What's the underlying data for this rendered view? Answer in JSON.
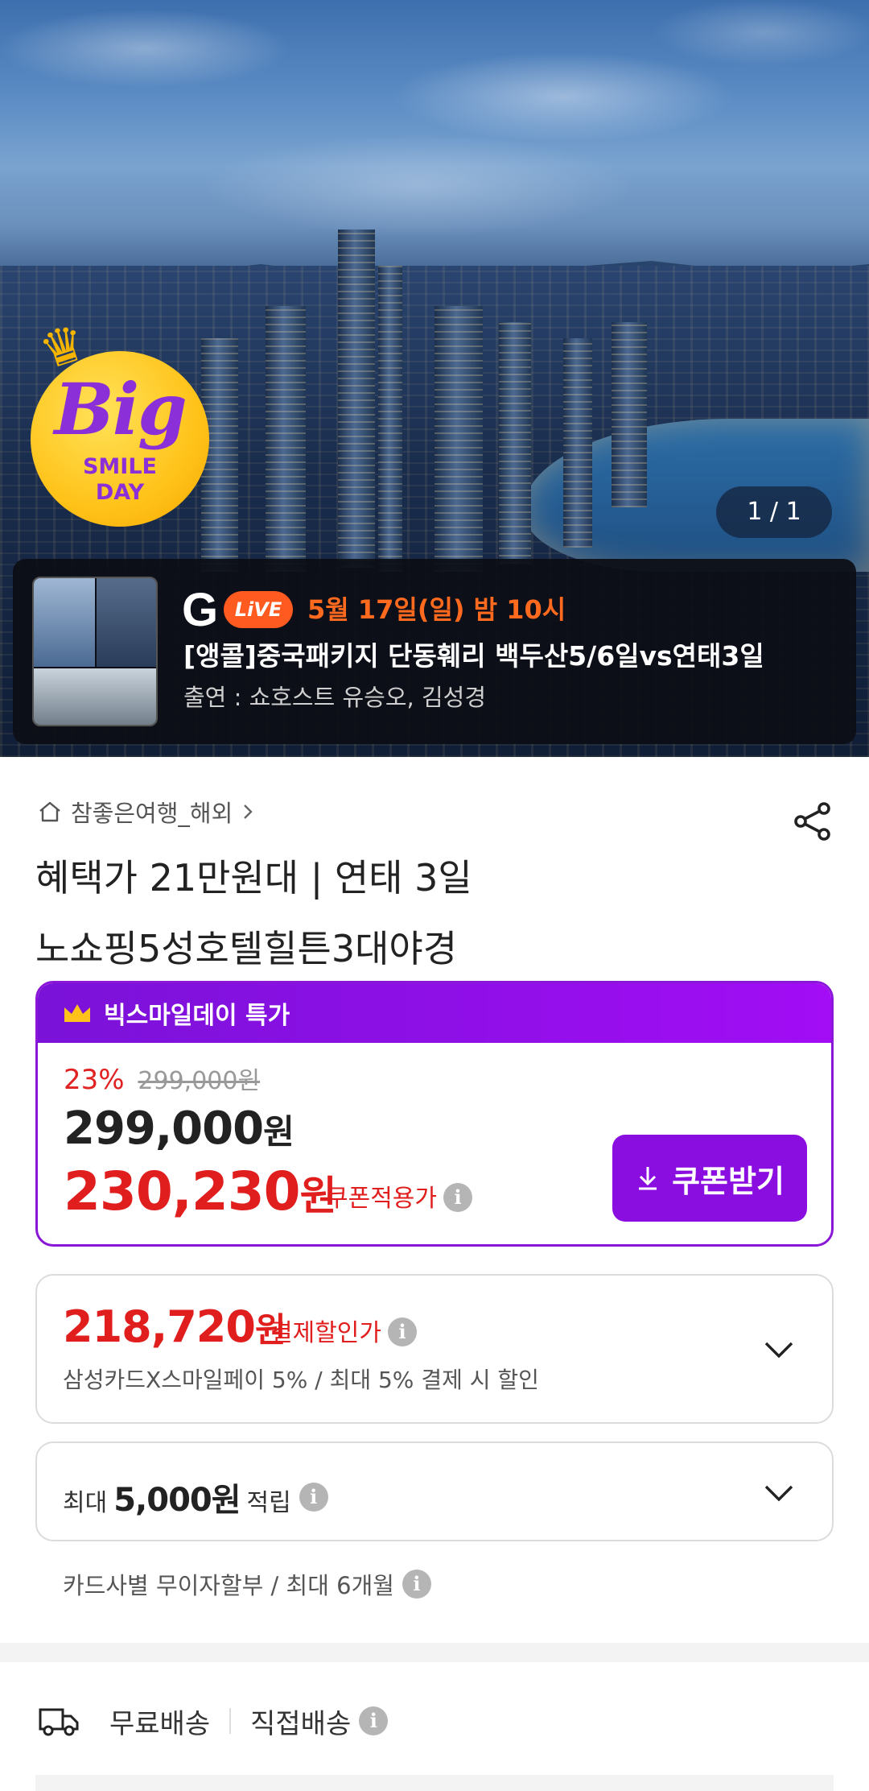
{
  "hero": {
    "badge": {
      "big": "Big",
      "smile": "SMILE",
      "day": "DAY"
    },
    "page_counter": "1 / 1",
    "live": {
      "g_logo": "G",
      "pill": "LiVE",
      "date": "5월 17일(일) 밤 10시",
      "title": "[앵콜]중국패키지 단동훼리 백두산5/6일vs연태3일",
      "cast": "출연 : 쇼호스트 유승오, 김성경"
    }
  },
  "product": {
    "store": "참좋은여행_해외",
    "title_line1": "혜택가 21만원대 | 연태 3일",
    "title_line2": "노쇼핑5성호텔힐튼3대야경"
  },
  "promo": {
    "header": "빅스마일데이 특가",
    "discount_pct": "23%",
    "original_price": "299,000원",
    "sale_price": "299,000",
    "coupon_price": "230,230",
    "won": "원",
    "coupon_label": "쿠폰적용가",
    "coupon_button": "쿠폰받기"
  },
  "payment": {
    "price": "218,720",
    "won": "원",
    "label": "결제할인가",
    "desc": "삼성카드X스마일페이 5% / 최대 5% 결제 시 할인"
  },
  "reward": {
    "prefix": "최대",
    "amount": "5,000원",
    "suffix": "적립"
  },
  "installment": "카드사별 무이자할부 / 최대 6개월",
  "shipping": {
    "free": "무료배송",
    "direct": "직접배송"
  },
  "colors": {
    "accent_purple": "#8a0ee0",
    "price_red": "#e01e1e",
    "live_orange": "#ff5a1f"
  }
}
